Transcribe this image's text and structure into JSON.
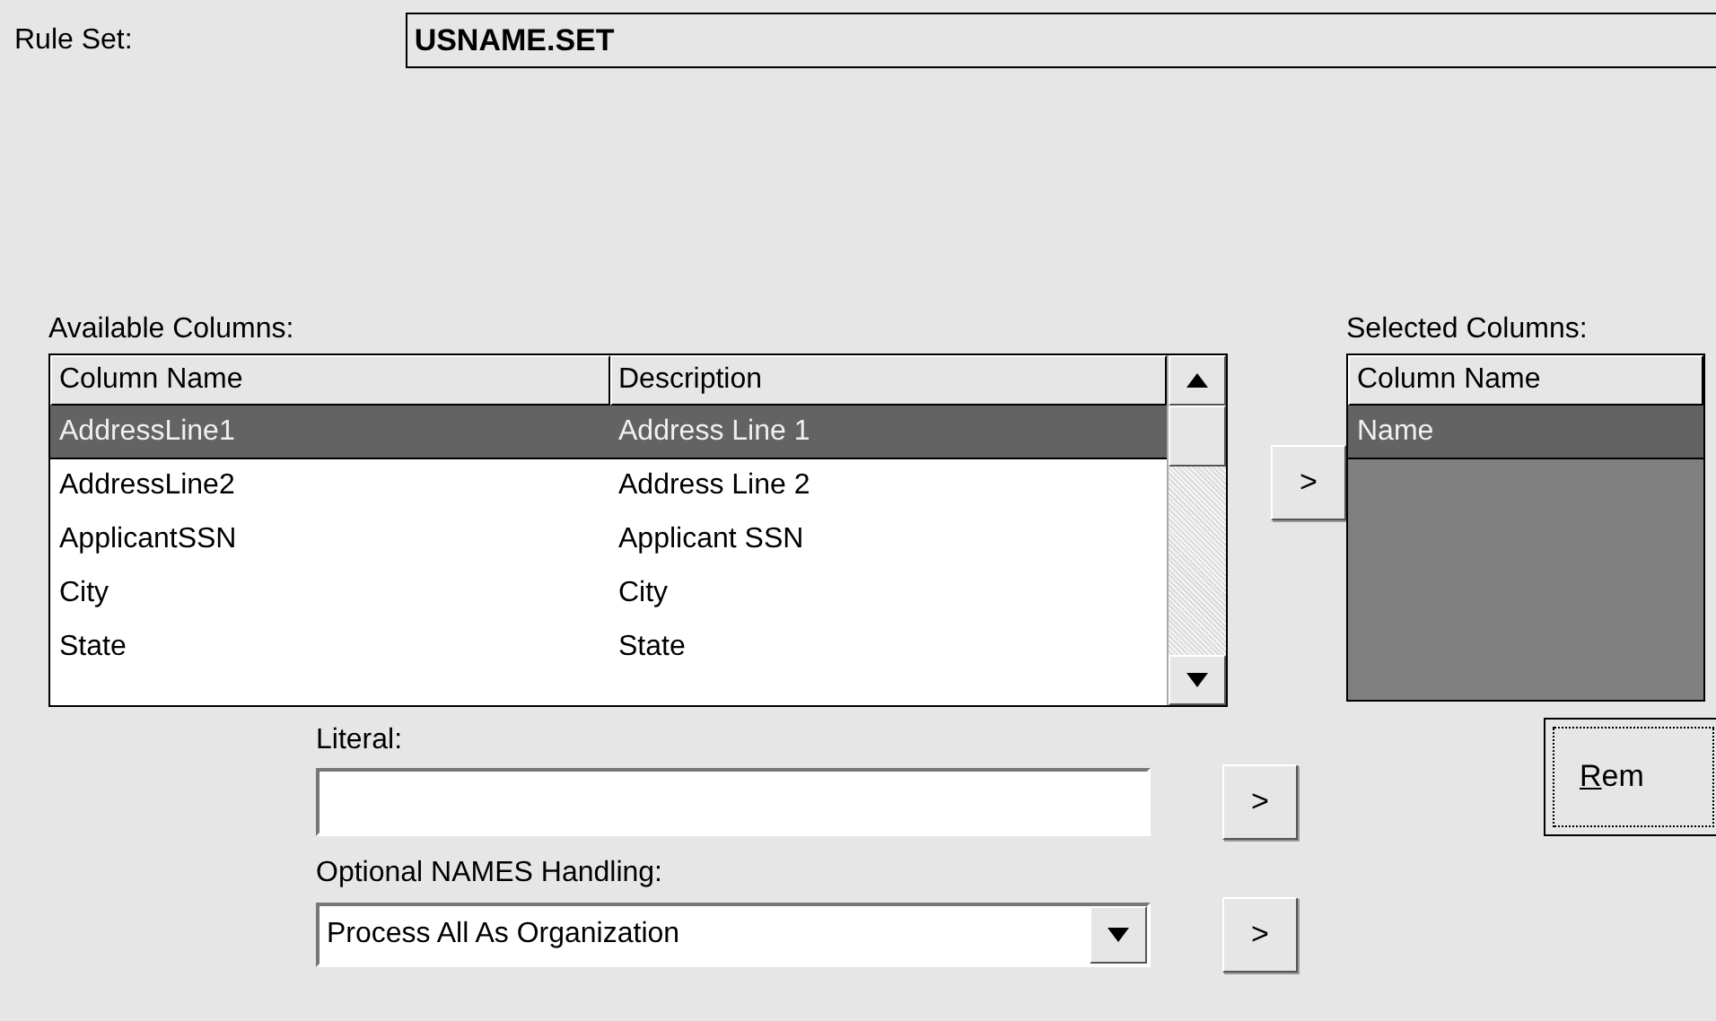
{
  "rule_set": {
    "label": "Rule Set:",
    "value": "USNAME.SET"
  },
  "available_columns": {
    "label": "Available Columns:",
    "columns": [
      "Column Name",
      "Description"
    ],
    "rows": [
      {
        "name": "AddressLine1",
        "description": "Address Line 1",
        "selected": true
      },
      {
        "name": "AddressLine2",
        "description": "Address Line 2",
        "selected": false
      },
      {
        "name": "ApplicantSSN",
        "description": "Applicant SSN",
        "selected": false
      },
      {
        "name": "City",
        "description": "City",
        "selected": false
      },
      {
        "name": "State",
        "description": "State",
        "selected": false
      }
    ]
  },
  "add_column_button": ">",
  "selected_columns": {
    "label": "Selected Columns:",
    "columns": [
      "Column Name"
    ],
    "rows": [
      {
        "name": "Name",
        "selected": true
      }
    ]
  },
  "remove_button": {
    "text": "Rem",
    "focused": true
  },
  "literal": {
    "label": "Literal:",
    "button": ">"
  },
  "names_handling": {
    "label": "Optional NAMES Handling:",
    "value": "Process All As Organization",
    "button": ">"
  }
}
